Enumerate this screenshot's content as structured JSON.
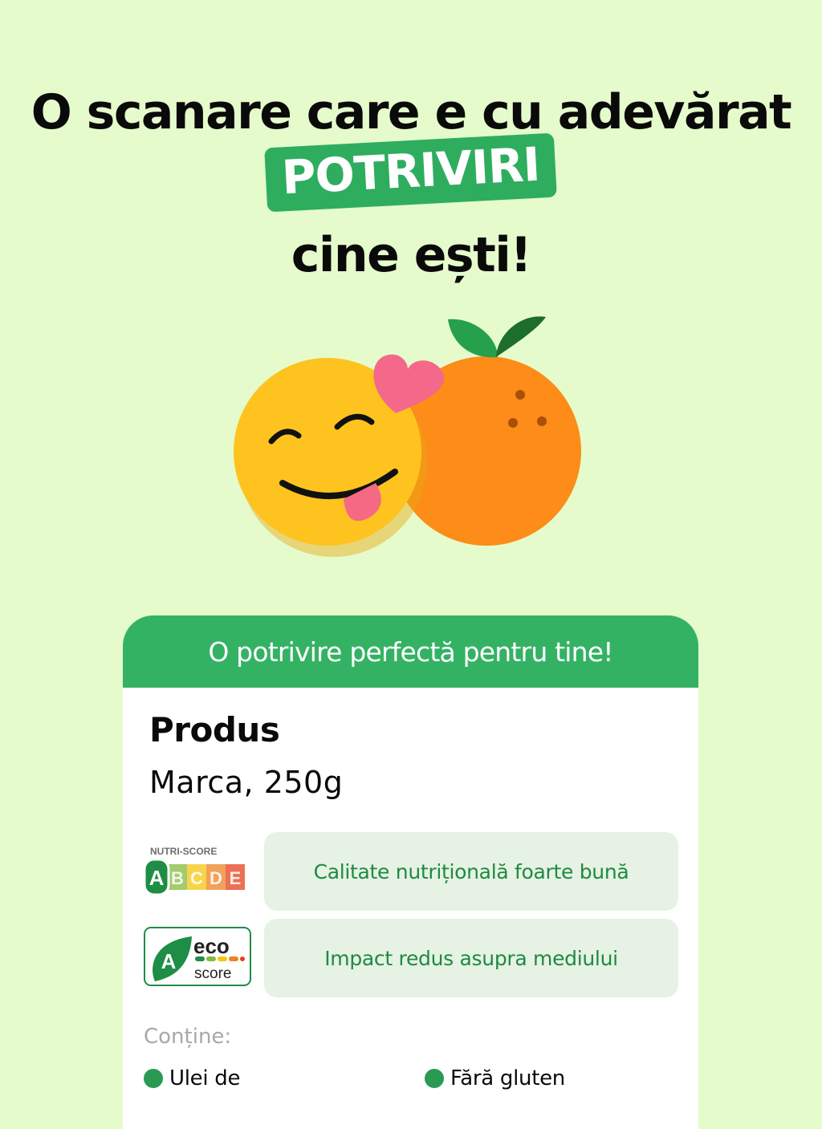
{
  "headline": {
    "line1": "O scanare care e cu adevărat",
    "highlight": "POTRIVIRI",
    "line3": "cine ești!"
  },
  "card": {
    "header": "O potrivire perfectă pentru tine!",
    "product_name": "Produs",
    "product_brand": "Marca, 250g",
    "nutri_score": {
      "title": "NUTRI-SCORE",
      "grades": [
        "A",
        "B",
        "C",
        "D",
        "E"
      ],
      "selected": "A",
      "label": "Calitate nutrițională foarte bună",
      "colors": [
        "#1e8d46",
        "#84bb3e",
        "#f6c60f",
        "#ee8121",
        "#e4401d"
      ]
    },
    "eco_score": {
      "grade": "A",
      "eco_text": "eco",
      "score_text": "score",
      "label": "Impact redus asupra mediului",
      "color": "#1e8d46"
    },
    "contains_label": "Conține:",
    "tags": [
      "Ulei de",
      "Fără gluten"
    ]
  },
  "colors": {
    "background": "#e5fbcc",
    "accent_green": "#34b264",
    "label_bg": "#e5f2e4",
    "label_text": "#1f8a40"
  }
}
